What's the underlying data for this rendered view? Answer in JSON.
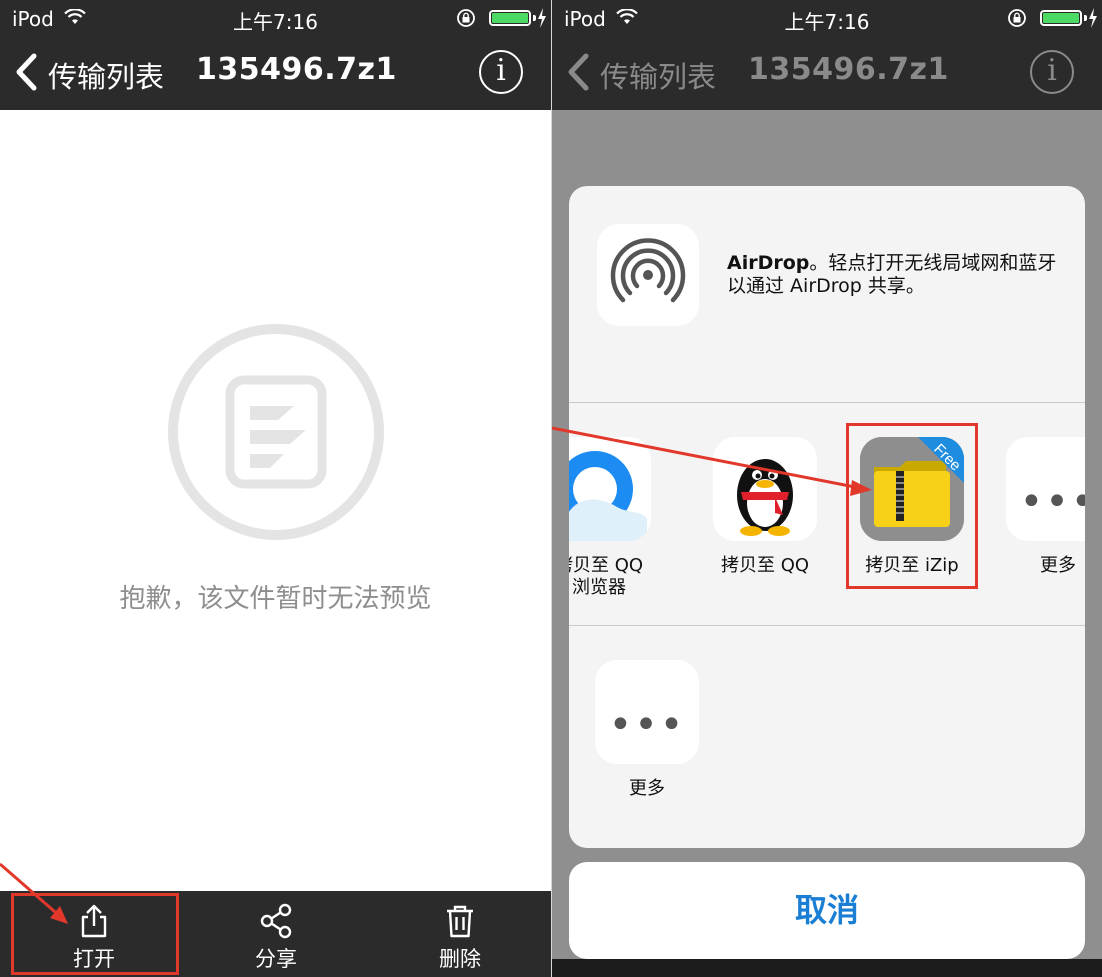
{
  "status": {
    "carrier": "iPod",
    "time": "上午7:16"
  },
  "nav": {
    "back_label": "传输列表",
    "title": "135496.7z1"
  },
  "preview": {
    "message": "抱歉，该文件暂时无法预览"
  },
  "toolbar": {
    "open_label": "打开",
    "share_label": "分享",
    "delete_label": "删除"
  },
  "share_sheet": {
    "airdrop_title": "AirDrop",
    "airdrop_desc": "。轻点打开无线局域网和蓝牙以通过 AirDrop 共享。",
    "apps": [
      {
        "label": "拷贝至 QQ浏览器"
      },
      {
        "label": "拷贝至 QQ"
      },
      {
        "label": "拷贝至 iZip"
      },
      {
        "label": "更多"
      }
    ],
    "actions": [
      {
        "label": "更多"
      }
    ],
    "izip_badge": "Free",
    "cancel_label": "取消"
  },
  "colors": {
    "bar_bg": "#2b2b2b",
    "highlight": "#e2382b",
    "cancel_text": "#1a7fd4",
    "battery": "#4cd964"
  }
}
